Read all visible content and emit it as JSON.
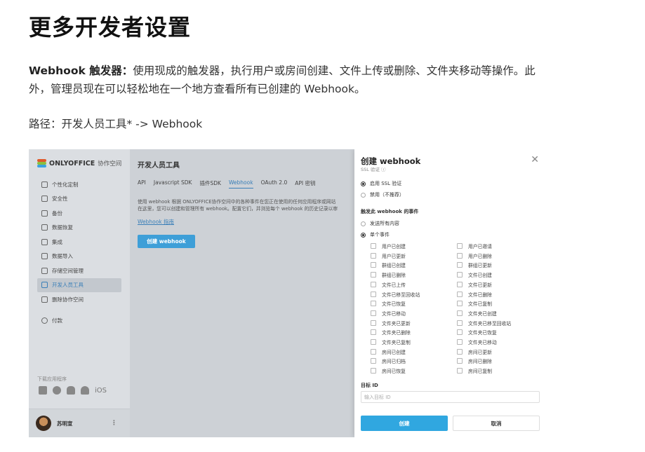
{
  "article": {
    "title": "更多开发者设置",
    "para1_bold": "Webhook 触发器：",
    "para1_text": "使用现成的触发器，执行用户或房间创建、文件上传或删除、文件夹移动等操作。此外，管理员现在可以轻松地在一个地方查看所有已创建的 Webhook。",
    "path_text": "路径：开发人员工具* -> Webhook"
  },
  "screenshot": {
    "logo": {
      "brand": "ONLYOFFICE",
      "sub": "协作空间"
    },
    "nav": [
      {
        "label": "个性化定制",
        "icon": "gear-icon"
      },
      {
        "label": "安全性",
        "icon": "shield-icon"
      },
      {
        "label": "备份",
        "icon": "save-icon"
      },
      {
        "label": "数据恢复",
        "icon": "restore-icon"
      },
      {
        "label": "集成",
        "icon": "grid-icon"
      },
      {
        "label": "数据导入",
        "icon": "import-icon"
      },
      {
        "label": "存储空间管理",
        "icon": "storage-icon"
      },
      {
        "label": "开发人员工具",
        "icon": "code-icon",
        "active": true
      },
      {
        "label": "删除协作空间",
        "icon": "trash-icon"
      }
    ],
    "pay_label": "付款",
    "apps_label": "下载应用程序",
    "apps_ios": "iOS",
    "user_name": "苏明宣",
    "content": {
      "title": "开发人员工具",
      "tabs": [
        "API",
        "Javascript SDK",
        "插件SDK",
        "Webhook",
        "OAuth 2.0",
        "API 密钥"
      ],
      "desc_line1": "使用 webhook 根据 ONLYOFFICE协作空间中的各种事件在您正在使用的任何应用程序或网站",
      "desc_line2": "在这里，您可以创建和管理所有 webhook。配置它们，并浏览每个 webhook 的历史记录以审",
      "guide_link": "Webhook 指南",
      "create_button": "创建 webhook"
    },
    "panel": {
      "title": "创建 webhook",
      "ssl_cut": "SSL 验证 ⓘ",
      "ssl_on": "启用 SSL 验证",
      "ssl_off": "禁用（不推荐）",
      "events_label": "触发此 webhook 的事件",
      "send_all": "发送所有内容",
      "single_event": "单个事件",
      "events_left": [
        "用户已创建",
        "用户已更新",
        "群组已创建",
        "群组已删除",
        "文件已上传",
        "文件已移至回收站",
        "文件已恢复",
        "文件已移动",
        "文件夹已更新",
        "文件夹已删除",
        "文件夹已复制",
        "房间已创建",
        "房间已归档",
        "房间已恢复"
      ],
      "events_right": [
        "用户已邀请",
        "用户已删除",
        "群组已更新",
        "文件已创建",
        "文件已更新",
        "文件已删除",
        "文件已复制",
        "文件夹已创建",
        "文件夹已移至回收站",
        "文件夹已恢复",
        "文件夹已移动",
        "房间已更新",
        "房间已删除",
        "房间已复制"
      ],
      "target_label": "目标 ID",
      "target_placeholder": "输入目标 ID",
      "create_label": "创建",
      "cancel_label": "取消"
    }
  }
}
